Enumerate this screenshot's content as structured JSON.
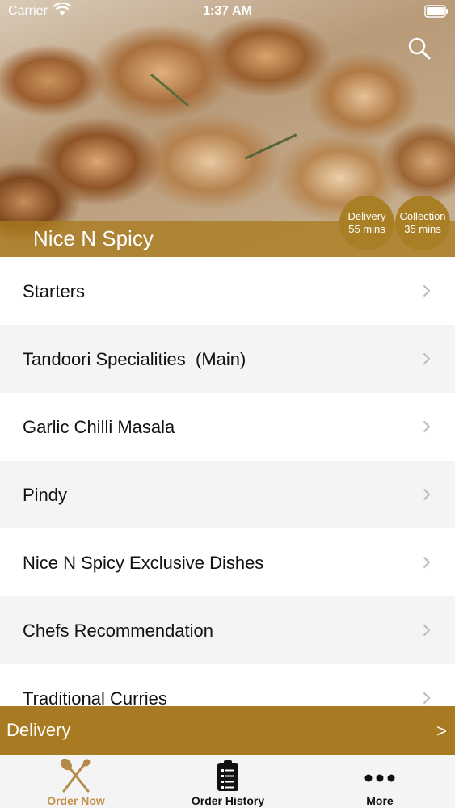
{
  "status_bar": {
    "carrier": "Carrier",
    "time": "1:37 AM"
  },
  "header": {
    "restaurant_name": "Nice N Spicy"
  },
  "badges": {
    "delivery": {
      "title": "Delivery",
      "time": "55 mins"
    },
    "collection": {
      "title": "Collection",
      "time": "35 mins"
    }
  },
  "menu": {
    "items": [
      {
        "label": "Starters"
      },
      {
        "label": "Tandoori Specialities  (Main)"
      },
      {
        "label": "Garlic Chilli Masala"
      },
      {
        "label": "Pindy"
      },
      {
        "label": "Nice N Spicy Exclusive Dishes"
      },
      {
        "label": "Chefs Recommendation"
      },
      {
        "label": "Traditional Curries"
      }
    ]
  },
  "delivery_bar": {
    "label": "Delivery",
    "arrow": ">"
  },
  "tabs": [
    {
      "label": "Order Now",
      "icon": "fork-spoon-icon",
      "active": true
    },
    {
      "label": "Order History",
      "icon": "clipboard-icon",
      "active": false
    },
    {
      "label": "More",
      "icon": "more-dots-icon",
      "active": false
    }
  ],
  "colors": {
    "accent": "#a87b22",
    "active_tab": "#c2914a"
  }
}
